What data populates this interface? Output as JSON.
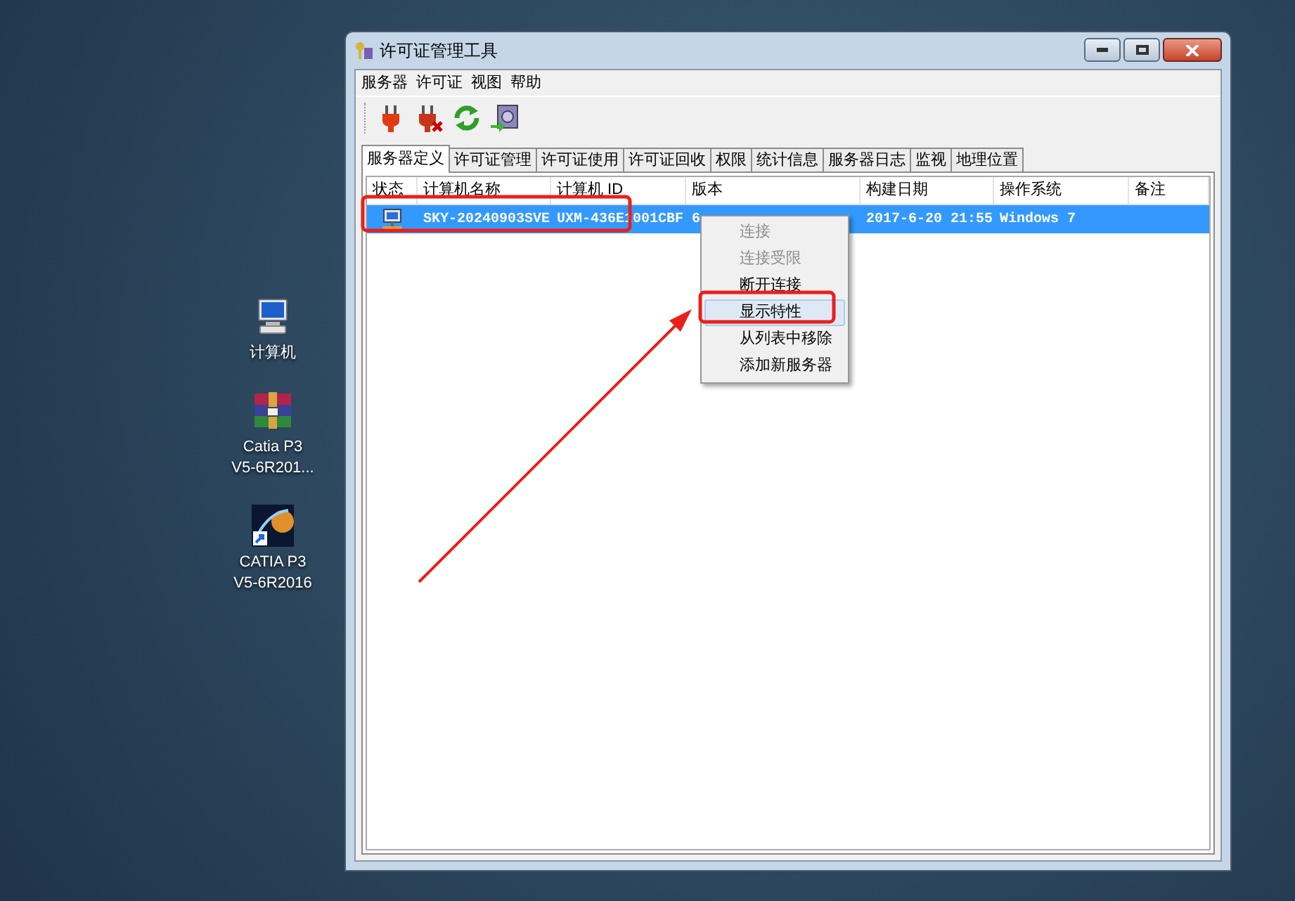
{
  "desktop_icons": [
    {
      "kind": "computer",
      "lines": [
        "计算机"
      ]
    },
    {
      "kind": "archive",
      "lines": [
        "Catia P3",
        "V5-6R201..."
      ]
    },
    {
      "kind": "shortcut",
      "lines": [
        "CATIA P3",
        "V5-6R2016"
      ]
    }
  ],
  "window": {
    "title": "许可证管理工具"
  },
  "menu_bar": [
    "服务器",
    "许可证",
    "视图",
    "帮助"
  ],
  "toolbar": [
    {
      "kind": "connect"
    },
    {
      "kind": "disconnect"
    },
    {
      "kind": "refresh"
    },
    {
      "kind": "export"
    }
  ],
  "tabs": [
    {
      "label": "服务器定义",
      "selected": true
    },
    {
      "label": "许可证管理",
      "selected": false
    },
    {
      "label": "许可证使用",
      "selected": false
    },
    {
      "label": "许可证回收",
      "selected": false
    },
    {
      "label": "权限",
      "selected": false
    },
    {
      "label": "统计信息",
      "selected": false
    },
    {
      "label": "服务器日志",
      "selected": false
    },
    {
      "label": "监视",
      "selected": false
    },
    {
      "label": "地理位置",
      "selected": false
    }
  ],
  "table": {
    "columns": [
      "状态",
      "计算机名称",
      "计算机 ID",
      "版本",
      "构建日期",
      "操作系统",
      "备注"
    ],
    "rows": [
      {
        "selected": true,
        "cells": [
          "",
          "SKY-20240903SVE",
          "UXM-436E1001CBF",
          "6",
          "2017-6-20 21:55",
          "Windows 7"
        ]
      }
    ]
  },
  "context_menu": [
    {
      "label": "连接",
      "disabled": true,
      "selected": false
    },
    {
      "label": "连接受限",
      "disabled": true,
      "selected": false
    },
    {
      "label": "断开连接",
      "disabled": false,
      "selected": false
    },
    {
      "label": "显示特性",
      "disabled": false,
      "selected": true
    },
    {
      "label": "从列表中移除",
      "disabled": false,
      "selected": false
    },
    {
      "label": "添加新服务器",
      "disabled": false,
      "selected": false
    }
  ]
}
